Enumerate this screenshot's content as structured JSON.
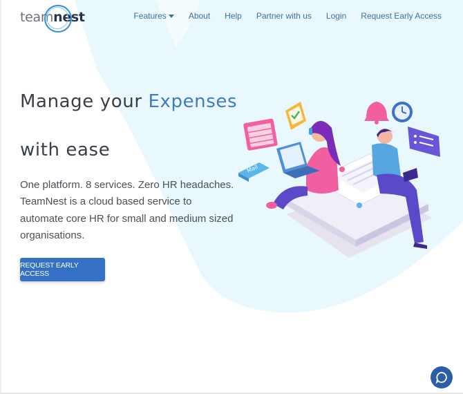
{
  "logo": {
    "part1": "team",
    "part2": "nest"
  },
  "nav": {
    "features": "Features",
    "about": "About",
    "help": "Help",
    "partner": "Partner with us",
    "login": "Login",
    "request": "Request Early Access"
  },
  "hero": {
    "title_part1": "Manage your ",
    "title_accent": "Expenses",
    "title_line2": "with ease",
    "subtitle": "One platform. 8 services. Zero HR headaches. TeamNest is a cloud based service to automate core HR for small and medium sized organisations.",
    "cta": "REQUEST EARLY ACCESS"
  },
  "illustration": {
    "mail_label": "Mail"
  },
  "icons": [
    "caret-down-icon",
    "chat-icon",
    "calendar-icon",
    "envelope-icon",
    "bell-icon",
    "clock-icon",
    "message-icon",
    "laptop-icon"
  ],
  "colors": {
    "accent": "#3f7bc4",
    "button": "#3471c5",
    "nav": "#3b6fa8",
    "background_shape": "#e9f8fd"
  }
}
